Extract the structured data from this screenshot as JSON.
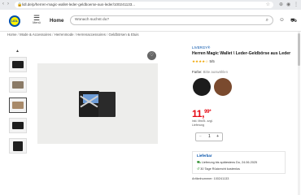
{
  "browser": {
    "url": "lidl.de/p/herren-magic-wallet-leder-geldboerse-aus-leder/100241133...",
    "back_icon": "back-arrow-icon",
    "forward_icon": "forward-arrow-icon",
    "reload_icon": "reload-icon"
  },
  "header": {
    "logo_text": "LIDL",
    "menu_label": "Menü",
    "home_label": "Home",
    "search_placeholder": "Wonach suchst du?",
    "colors": {
      "brand_blue": "#0050aa",
      "brand_yellow": "#fff200",
      "price_red": "#e60a14"
    }
  },
  "breadcrumb": [
    "Home",
    "Mode & Accessoires",
    "Herrenmode",
    "Herrenaccessoires",
    "Geldbörsen & Etuis"
  ],
  "gallery": {
    "thumbnail_count": 5,
    "selected_index": 2
  },
  "product": {
    "brand": "LIVERGY®",
    "title": "Herren Magic Wallet \\ Leder-Geldbörse aus Leder",
    "rating_stars": "★★★★☆",
    "rating_value": "5/5",
    "color_label": "Farbe:",
    "color_hint": "Bitte auswählen",
    "swatches": [
      {
        "name": "schwarz",
        "color": "#1c1c1c"
      },
      {
        "name": "braun",
        "color": "#7a4a2e"
      }
    ],
    "price_main": "11,",
    "price_cents": "99",
    "price_star": "*",
    "price_info_1": "inkl. MwSt. zzgl.",
    "price_info_2": "Lieferung",
    "quantity": "1",
    "qty_minus": "−",
    "qty_plus": "+"
  },
  "delivery": {
    "heading": "Lieferbar",
    "line1": "Lieferung bis spätestens Do, 24.06.2025",
    "line2": "30 Tage Rückrecht kostenlos",
    "article_number": "Artikelnummer: 100241133"
  }
}
